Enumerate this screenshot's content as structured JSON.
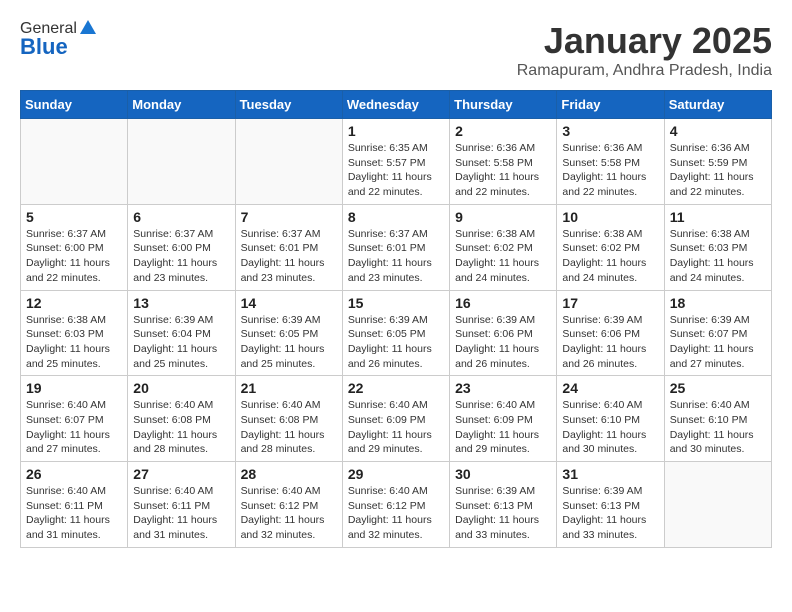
{
  "header": {
    "logo_general": "General",
    "logo_blue": "Blue",
    "title": "January 2025",
    "location": "Ramapuram, Andhra Pradesh, India"
  },
  "weekdays": [
    "Sunday",
    "Monday",
    "Tuesday",
    "Wednesday",
    "Thursday",
    "Friday",
    "Saturday"
  ],
  "weeks": [
    [
      {
        "day": "",
        "info": ""
      },
      {
        "day": "",
        "info": ""
      },
      {
        "day": "",
        "info": ""
      },
      {
        "day": "1",
        "info": "Sunrise: 6:35 AM\nSunset: 5:57 PM\nDaylight: 11 hours\nand 22 minutes."
      },
      {
        "day": "2",
        "info": "Sunrise: 6:36 AM\nSunset: 5:58 PM\nDaylight: 11 hours\nand 22 minutes."
      },
      {
        "day": "3",
        "info": "Sunrise: 6:36 AM\nSunset: 5:58 PM\nDaylight: 11 hours\nand 22 minutes."
      },
      {
        "day": "4",
        "info": "Sunrise: 6:36 AM\nSunset: 5:59 PM\nDaylight: 11 hours\nand 22 minutes."
      }
    ],
    [
      {
        "day": "5",
        "info": "Sunrise: 6:37 AM\nSunset: 6:00 PM\nDaylight: 11 hours\nand 22 minutes."
      },
      {
        "day": "6",
        "info": "Sunrise: 6:37 AM\nSunset: 6:00 PM\nDaylight: 11 hours\nand 23 minutes."
      },
      {
        "day": "7",
        "info": "Sunrise: 6:37 AM\nSunset: 6:01 PM\nDaylight: 11 hours\nand 23 minutes."
      },
      {
        "day": "8",
        "info": "Sunrise: 6:37 AM\nSunset: 6:01 PM\nDaylight: 11 hours\nand 23 minutes."
      },
      {
        "day": "9",
        "info": "Sunrise: 6:38 AM\nSunset: 6:02 PM\nDaylight: 11 hours\nand 24 minutes."
      },
      {
        "day": "10",
        "info": "Sunrise: 6:38 AM\nSunset: 6:02 PM\nDaylight: 11 hours\nand 24 minutes."
      },
      {
        "day": "11",
        "info": "Sunrise: 6:38 AM\nSunset: 6:03 PM\nDaylight: 11 hours\nand 24 minutes."
      }
    ],
    [
      {
        "day": "12",
        "info": "Sunrise: 6:38 AM\nSunset: 6:03 PM\nDaylight: 11 hours\nand 25 minutes."
      },
      {
        "day": "13",
        "info": "Sunrise: 6:39 AM\nSunset: 6:04 PM\nDaylight: 11 hours\nand 25 minutes."
      },
      {
        "day": "14",
        "info": "Sunrise: 6:39 AM\nSunset: 6:05 PM\nDaylight: 11 hours\nand 25 minutes."
      },
      {
        "day": "15",
        "info": "Sunrise: 6:39 AM\nSunset: 6:05 PM\nDaylight: 11 hours\nand 26 minutes."
      },
      {
        "day": "16",
        "info": "Sunrise: 6:39 AM\nSunset: 6:06 PM\nDaylight: 11 hours\nand 26 minutes."
      },
      {
        "day": "17",
        "info": "Sunrise: 6:39 AM\nSunset: 6:06 PM\nDaylight: 11 hours\nand 26 minutes."
      },
      {
        "day": "18",
        "info": "Sunrise: 6:39 AM\nSunset: 6:07 PM\nDaylight: 11 hours\nand 27 minutes."
      }
    ],
    [
      {
        "day": "19",
        "info": "Sunrise: 6:40 AM\nSunset: 6:07 PM\nDaylight: 11 hours\nand 27 minutes."
      },
      {
        "day": "20",
        "info": "Sunrise: 6:40 AM\nSunset: 6:08 PM\nDaylight: 11 hours\nand 28 minutes."
      },
      {
        "day": "21",
        "info": "Sunrise: 6:40 AM\nSunset: 6:08 PM\nDaylight: 11 hours\nand 28 minutes."
      },
      {
        "day": "22",
        "info": "Sunrise: 6:40 AM\nSunset: 6:09 PM\nDaylight: 11 hours\nand 29 minutes."
      },
      {
        "day": "23",
        "info": "Sunrise: 6:40 AM\nSunset: 6:09 PM\nDaylight: 11 hours\nand 29 minutes."
      },
      {
        "day": "24",
        "info": "Sunrise: 6:40 AM\nSunset: 6:10 PM\nDaylight: 11 hours\nand 30 minutes."
      },
      {
        "day": "25",
        "info": "Sunrise: 6:40 AM\nSunset: 6:10 PM\nDaylight: 11 hours\nand 30 minutes."
      }
    ],
    [
      {
        "day": "26",
        "info": "Sunrise: 6:40 AM\nSunset: 6:11 PM\nDaylight: 11 hours\nand 31 minutes."
      },
      {
        "day": "27",
        "info": "Sunrise: 6:40 AM\nSunset: 6:11 PM\nDaylight: 11 hours\nand 31 minutes."
      },
      {
        "day": "28",
        "info": "Sunrise: 6:40 AM\nSunset: 6:12 PM\nDaylight: 11 hours\nand 32 minutes."
      },
      {
        "day": "29",
        "info": "Sunrise: 6:40 AM\nSunset: 6:12 PM\nDaylight: 11 hours\nand 32 minutes."
      },
      {
        "day": "30",
        "info": "Sunrise: 6:39 AM\nSunset: 6:13 PM\nDaylight: 11 hours\nand 33 minutes."
      },
      {
        "day": "31",
        "info": "Sunrise: 6:39 AM\nSunset: 6:13 PM\nDaylight: 11 hours\nand 33 minutes."
      },
      {
        "day": "",
        "info": ""
      }
    ]
  ]
}
